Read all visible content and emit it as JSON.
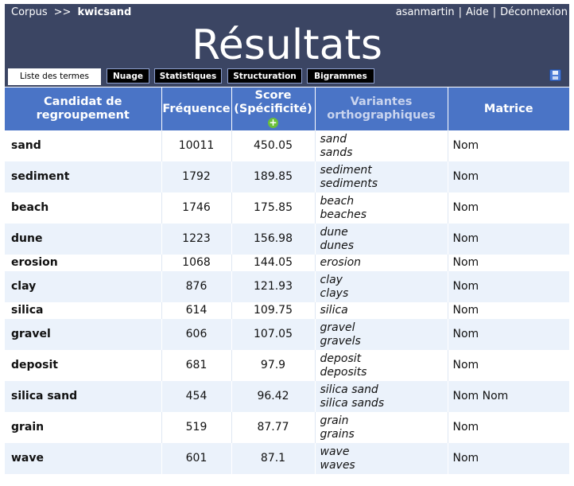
{
  "header": {
    "breadcrumb_root": "Corpus",
    "breadcrumb_sep": ">>",
    "corpus_name": "kwicsand",
    "user": "asanmartin",
    "help": "Aide",
    "logout": "Déconnexion",
    "title": "Résultats"
  },
  "tabs": [
    "Liste des termes",
    "Nuage",
    "Statistiques",
    "Structuration",
    "Bigrammes"
  ],
  "table": {
    "headers": {
      "candidate": "Candidat de regroupement",
      "frequency": "Fréquence",
      "score": "Score (Spécificité)",
      "variants": "Variantes orthographiques",
      "matrix": "Matrice"
    },
    "rows": [
      {
        "term": "sand",
        "freq": "10011",
        "score": "450.05",
        "variants": [
          "sand",
          "sands"
        ],
        "matrix": "Nom"
      },
      {
        "term": "sediment",
        "freq": "1792",
        "score": "189.85",
        "variants": [
          "sediment",
          "sediments"
        ],
        "matrix": "Nom"
      },
      {
        "term": "beach",
        "freq": "1746",
        "score": "175.85",
        "variants": [
          "beach",
          "beaches"
        ],
        "matrix": "Nom"
      },
      {
        "term": "dune",
        "freq": "1223",
        "score": "156.98",
        "variants": [
          "dune",
          "dunes"
        ],
        "matrix": "Nom"
      },
      {
        "term": "erosion",
        "freq": "1068",
        "score": "144.05",
        "variants": [
          "erosion"
        ],
        "matrix": "Nom"
      },
      {
        "term": "clay",
        "freq": "876",
        "score": "121.93",
        "variants": [
          "clay",
          "clays"
        ],
        "matrix": "Nom"
      },
      {
        "term": "silica",
        "freq": "614",
        "score": "109.75",
        "variants": [
          "silica"
        ],
        "matrix": "Nom"
      },
      {
        "term": "gravel",
        "freq": "606",
        "score": "107.05",
        "variants": [
          "gravel",
          "gravels"
        ],
        "matrix": "Nom"
      },
      {
        "term": "deposit",
        "freq": "681",
        "score": "97.9",
        "variants": [
          "deposit",
          "deposits"
        ],
        "matrix": "Nom"
      },
      {
        "term": "silica sand",
        "freq": "454",
        "score": "96.42",
        "variants": [
          "silica sand",
          "silica sands"
        ],
        "matrix": "Nom Nom"
      },
      {
        "term": "grain",
        "freq": "519",
        "score": "87.77",
        "variants": [
          "grain",
          "grains"
        ],
        "matrix": "Nom"
      },
      {
        "term": "wave",
        "freq": "601",
        "score": "87.1",
        "variants": [
          "wave",
          "waves"
        ],
        "matrix": "Nom"
      }
    ]
  }
}
